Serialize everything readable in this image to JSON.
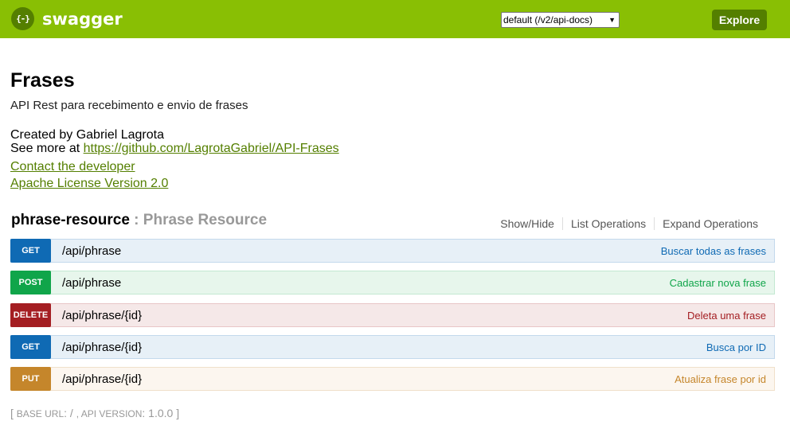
{
  "header": {
    "logo_glyph": "{-}",
    "logo_text": "swagger",
    "spec_selected": "default (/v2/api-docs)",
    "explore_label": "Explore",
    "bg_color": "#89bf04",
    "accent_color": "#547f00"
  },
  "info": {
    "title": "Frases",
    "description": "API Rest para recebimento e envio de frases",
    "created_by": "Created by Gabriel Lagrota",
    "see_more_prefix": "See more at ",
    "see_more_link": "https://github.com/LagrotaGabriel/API-Frases",
    "contact_link": "Contact the developer",
    "license_link": "Apache License Version 2.0"
  },
  "resource": {
    "name": "phrase-resource",
    "separator": " : ",
    "description": "Phrase Resource",
    "options": [
      "Show/Hide",
      "List Operations",
      "Expand Operations"
    ]
  },
  "operations": [
    {
      "method": "GET",
      "path": "/api/phrase",
      "summary": "Buscar todas as frases",
      "color": "#0f6ab4",
      "bg": "#e7f0f7",
      "border": "#c3d9ec",
      "summary_color": "#0f6ab4"
    },
    {
      "method": "POST",
      "path": "/api/phrase",
      "summary": "Cadastrar nova frase",
      "color": "#10a54a",
      "bg": "#e7f6ec",
      "border": "#c3e8d1",
      "summary_color": "#10a54a"
    },
    {
      "method": "DELETE",
      "path": "/api/phrase/{id}",
      "summary": "Deleta uma frase",
      "color": "#a41e22",
      "bg": "#f5e8e8",
      "border": "#e8c6c7",
      "summary_color": "#a41e22"
    },
    {
      "method": "GET",
      "path": "/api/phrase/{id}",
      "summary": "Busca por ID",
      "color": "#0f6ab4",
      "bg": "#e7f0f7",
      "border": "#c3d9ec",
      "summary_color": "#0f6ab4"
    },
    {
      "method": "PUT",
      "path": "/api/phrase/{id}",
      "summary": "Atualiza frase por id",
      "color": "#c5862b",
      "bg": "#fcf6ef",
      "border": "#f0e0ca",
      "summary_color": "#c5862b"
    }
  ],
  "footer": {
    "open": "[ ",
    "base_url_label": "BASE URL",
    "base_url_value": ": / ",
    "api_version_label": ", API VERSION",
    "api_version_value": ": 1.0.0 ",
    "close": "]"
  }
}
